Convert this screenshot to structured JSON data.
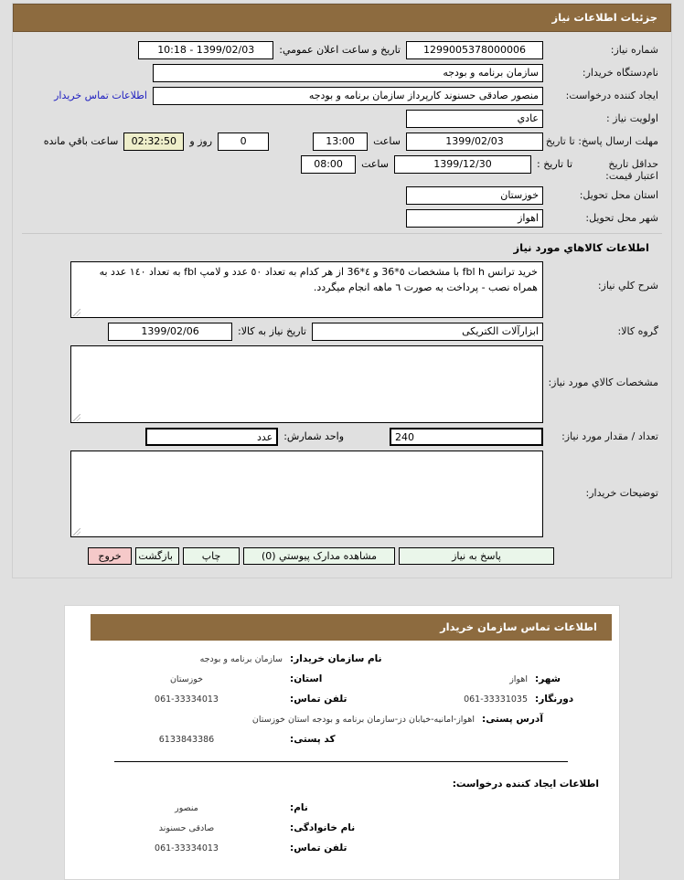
{
  "header": {
    "title": "جزئیات اطلاعات نیاز",
    "accent_color": "#8d6b3f",
    "header_text_color": "#ffffff"
  },
  "form": {
    "need_number_label": "شماره نیاز:",
    "need_number_value": "1299005378000006",
    "announce_label": "تاریخ و ساعت اعلان عمومي:",
    "announce_value": "1399/02/03 - 10:18",
    "buyer_org_label": "نام‌دستگاه خریدار:",
    "buyer_org_value": "سازمان برنامه و بودجه",
    "creator_label": "ایجاد کننده درخواست:",
    "creator_value": "منصور صادقی حسنوند کارپرداز سازمان برنامه و بودجه",
    "contact_link": "اطلاعات تماس خریدار",
    "priority_label": "اولویت نیاز :",
    "priority_value": "عادي",
    "deadline_label": "مهلت ارسال پاسخ: تا تاریخ :",
    "deadline_date": "1399/02/03",
    "hour_label": "ساعت",
    "deadline_hour": "13:00",
    "days_remaining": "0",
    "days_label": "روز و",
    "time_remaining": "02:32:50",
    "time_remaining_label": "ساعت باقي مانده",
    "min_validity_label": "حداقل تاریخ اعتبار قیمت:",
    "min_validity_to_label": "تا تاریخ :",
    "min_validity_date": "1399/12/30",
    "min_validity_hour": "08:00",
    "province_label": "استان محل تحویل:",
    "province_value": "خوزستان",
    "city_label": "شهر محل تحویل:",
    "city_value": "اهواز"
  },
  "goods": {
    "section_title": "اطلاعات کالاهاي مورد نیاز",
    "desc_label": "شرح کلي نیاز:",
    "desc_value": "خرید ترانس fbl  h   با مشخصات ٥*36 و ٤*36 از هر کدام به تعداد ٥٠ عدد و لامپ fbl به تعداد ١٤٠ عدد به همراه نصب - پرداخت به صورت ٦ ماهه انجام میگردد.",
    "group_label": "گروه کالا:",
    "group_value": "ابزارآلات الکتریکی",
    "need_date_label": "تاریخ نیاز به کالا:",
    "need_date_value": "1399/02/06",
    "specs_label": "مشخصات کالاي مورد نیاز:",
    "specs_value": "",
    "qty_label": "تعداد / مقدار مورد نیاز:",
    "qty_value": "240",
    "unit_label": "واحد شمارش:",
    "unit_value": "عدد",
    "buyer_notes_label": "توضیحات خریدار:",
    "buyer_notes_value": ""
  },
  "buttons": {
    "respond": "پاسخ به نیاز",
    "attachments": "مشاهده مدارک پیوستي (0)",
    "print": "چاپ",
    "back": "بازگشت",
    "exit": "خروج",
    "exit_color": "#f5c9c9",
    "normal_color": "#eaf6ea"
  },
  "contact": {
    "title": "اطلاعات تماس سازمان خریدار",
    "org_name_label": "نام سازمان خریدار:",
    "org_name_value": "سازمان برنامه و بودجه",
    "province_label": "استان:",
    "province_value": "خوزستان",
    "city_label": "شهر:",
    "city_value": "اهواز",
    "phone_label": "تلفن تماس:",
    "phone_value": "061-33334013",
    "fax_label": "دورنگار:",
    "fax_value": "061-33331035",
    "address_label": "آدرس پستی:",
    "address_value": "اهواز-امانیه-خیابان دز-سازمان برنامه و بودجه استان خوزستان",
    "postal_label": "کد پستی:",
    "postal_value": "6133843386"
  },
  "requester": {
    "title": "اطلاعات ایجاد کننده درخواست:",
    "firstname_label": "نام:",
    "firstname_value": "منصور",
    "lastname_label": "نام خانوادگی:",
    "lastname_value": "صادقی  حسنوند",
    "phone_label": "تلفن تماس:",
    "phone_value": "061-33334013"
  }
}
